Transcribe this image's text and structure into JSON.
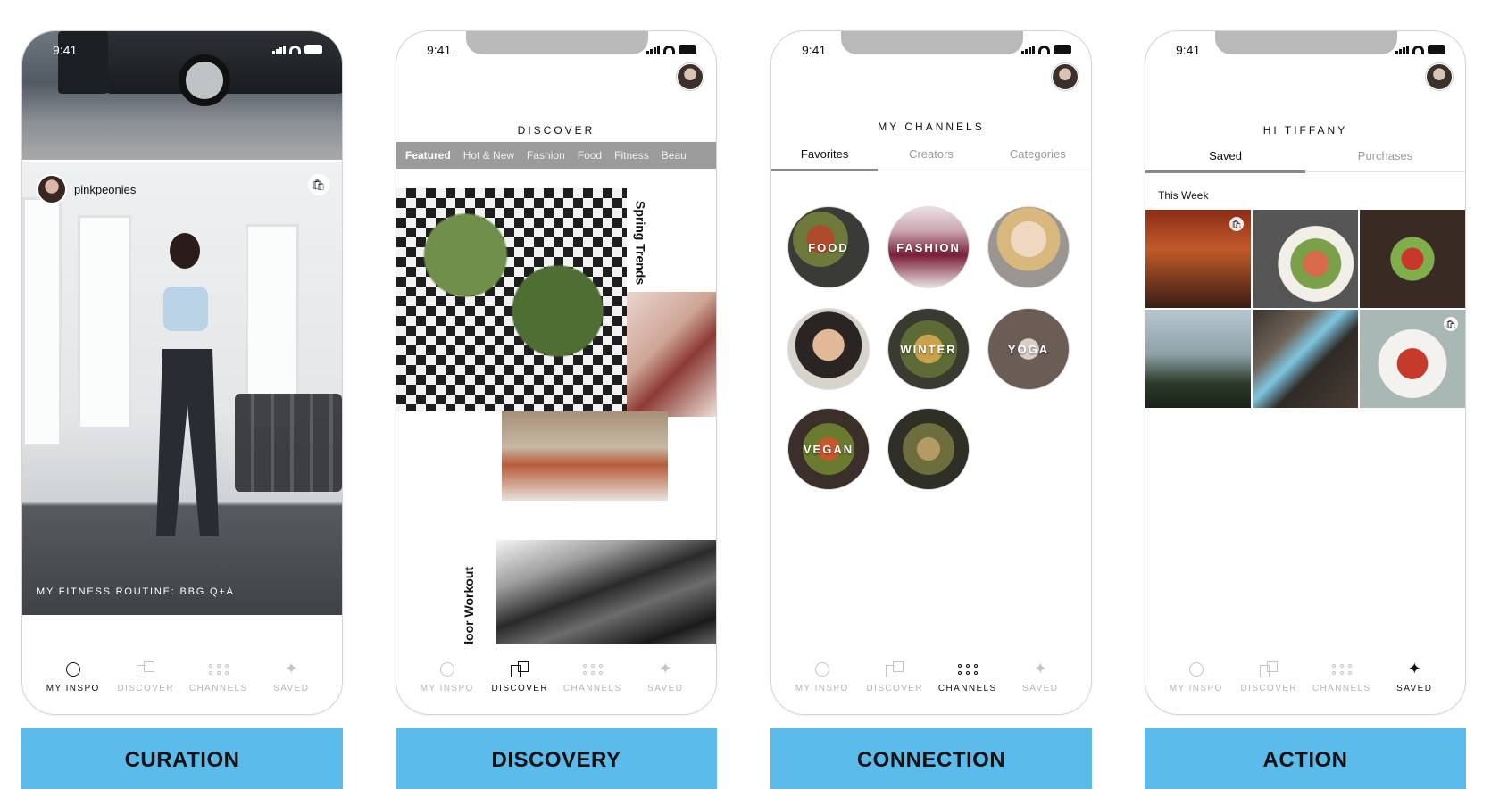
{
  "status_time": "9:41",
  "tabbar": {
    "my_inspo": "MY INSPO",
    "discover": "DISCOVER",
    "channels": "CHANNELS",
    "saved": "SAVED"
  },
  "screens": [
    {
      "banner": "CURATION",
      "username": "pinkpeonies",
      "caption": "MY FITNESS ROUTINE: BBG Q+A"
    },
    {
      "banner": "DISCOVERY",
      "title": "DISCOVER",
      "subtabs": [
        "Featured",
        "Hot & New",
        "Fashion",
        "Food",
        "Fitness",
        "Beau"
      ],
      "label_spring": "Spring Trends",
      "label_outdoor": "Outdoor Workout"
    },
    {
      "banner": "CONNECTION",
      "title": "MY CHANNELS",
      "segments": [
        "Favorites",
        "Creators",
        "Categories"
      ],
      "channels": [
        "FOOD",
        "FASHION",
        "",
        "",
        "WINTER",
        "YOGA",
        "VEGAN",
        ""
      ]
    },
    {
      "banner": "ACTION",
      "title": "HI TIFFANY",
      "segments": [
        "Saved",
        "Purchases"
      ],
      "section": "This Week"
    }
  ],
  "colors": {
    "banner": "#5bbcec",
    "subtab_bar": "#9b9b9b"
  },
  "icons": [
    "ring-icon",
    "squares-icon",
    "dots-icon",
    "sparkle-icon",
    "bag-icon"
  ]
}
